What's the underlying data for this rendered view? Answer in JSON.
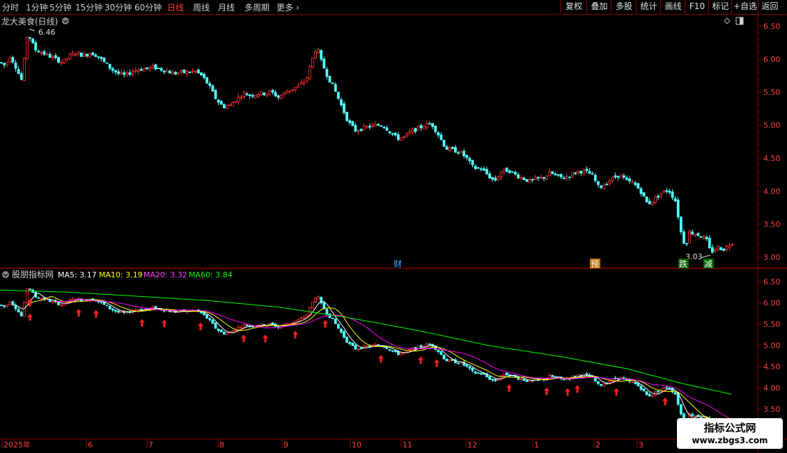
{
  "toolbar": {
    "periods": [
      "分时",
      "1分钟",
      "5分钟",
      "15分钟",
      "30分钟",
      "60分钟",
      "日线",
      "周线",
      "月线",
      "多周期",
      "更多"
    ],
    "active_period": "日线",
    "buttons": [
      "复权",
      "叠加",
      "多股",
      "统计",
      "画线",
      "F10",
      "标记",
      "+自选",
      "返回"
    ]
  },
  "main_chart": {
    "title": "龙大美食(日线)",
    "high_label": "6.46",
    "low_label": "3.03",
    "events": [
      "财",
      "预",
      "跌",
      "减"
    ]
  },
  "indicator": {
    "name": "股朋指标网",
    "ma5": "MA5: 3.17",
    "ma10": "MA10: 3.19",
    "ma20": "MA20: 3.32",
    "ma60": "MA60: 3.84"
  },
  "x_axis": {
    "labels": [
      "2025年",
      "6",
      "7",
      "8",
      "9",
      "10",
      "11",
      "12",
      "1",
      "2",
      "3"
    ]
  },
  "watermark": {
    "title": "指标公式网",
    "url": "www.zbgs3.com"
  },
  "colors": {
    "up": "#ff3232",
    "down": "#54ffff",
    "ma5": "#ffffff",
    "ma10": "#ffff00",
    "ma20": "#ff00ff",
    "ma60": "#00ff00",
    "grid": "#8b0000"
  },
  "chart_data": {
    "type": "candlestick",
    "price_ticks": [
      "6.50",
      "6.00",
      "5.50",
      "5.00",
      "4.50",
      "4.00",
      "3.50",
      "3.00"
    ],
    "sub_price_ticks": [
      "6.50",
      "6.00",
      "5.50",
      "5.00",
      "4.50",
      "4.00",
      "3.50"
    ],
    "ylim": [
      2.95,
      6.55
    ],
    "sub_ylim": [
      3.35,
      6.6
    ],
    "path": [
      [
        0,
        5.95
      ],
      [
        8,
        5.9
      ],
      [
        14,
        6.05
      ],
      [
        20,
        5.95
      ],
      [
        26,
        5.8
      ],
      [
        30,
        5.7
      ],
      [
        33,
        5.65
      ],
      [
        36,
        6.2
      ],
      [
        40,
        6.4
      ],
      [
        44,
        6.3
      ],
      [
        50,
        6.15
      ],
      [
        60,
        6.1
      ],
      [
        70,
        6.05
      ],
      [
        80,
        6.0
      ],
      [
        90,
        5.95
      ],
      [
        100,
        6.05
      ],
      [
        110,
        6.1
      ],
      [
        120,
        6.05
      ],
      [
        130,
        6.1
      ],
      [
        140,
        6.05
      ],
      [
        150,
        5.95
      ],
      [
        160,
        5.85
      ],
      [
        170,
        5.78
      ],
      [
        180,
        5.75
      ],
      [
        190,
        5.82
      ],
      [
        200,
        5.85
      ],
      [
        210,
        5.85
      ],
      [
        220,
        5.88
      ],
      [
        230,
        5.85
      ],
      [
        240,
        5.82
      ],
      [
        250,
        5.78
      ],
      [
        260,
        5.8
      ],
      [
        270,
        5.8
      ],
      [
        280,
        5.82
      ],
      [
        290,
        5.75
      ],
      [
        300,
        5.6
      ],
      [
        310,
        5.4
      ],
      [
        320,
        5.28
      ],
      [
        330,
        5.3
      ],
      [
        340,
        5.4
      ],
      [
        350,
        5.48
      ],
      [
        360,
        5.45
      ],
      [
        370,
        5.48
      ],
      [
        380,
        5.48
      ],
      [
        390,
        5.5
      ],
      [
        400,
        5.42
      ],
      [
        410,
        5.5
      ],
      [
        420,
        5.55
      ],
      [
        430,
        5.6
      ],
      [
        440,
        5.7
      ],
      [
        450,
        6.05
      ],
      [
        455,
        6.2
      ],
      [
        460,
        6.0
      ],
      [
        470,
        5.75
      ],
      [
        480,
        5.55
      ],
      [
        490,
        5.3
      ],
      [
        500,
        5.05
      ],
      [
        510,
        4.92
      ],
      [
        520,
        4.95
      ],
      [
        530,
        4.98
      ],
      [
        540,
        5.0
      ],
      [
        550,
        5.0
      ],
      [
        560,
        4.9
      ],
      [
        570,
        4.8
      ],
      [
        580,
        4.82
      ],
      [
        590,
        4.9
      ],
      [
        600,
        4.95
      ],
      [
        610,
        5.0
      ],
      [
        620,
        5.02
      ],
      [
        630,
        4.85
      ],
      [
        640,
        4.65
      ],
      [
        650,
        4.62
      ],
      [
        660,
        4.6
      ],
      [
        670,
        4.5
      ],
      [
        680,
        4.35
      ],
      [
        690,
        4.35
      ],
      [
        700,
        4.25
      ],
      [
        710,
        4.15
      ],
      [
        720,
        4.3
      ],
      [
        730,
        4.32
      ],
      [
        740,
        4.25
      ],
      [
        750,
        4.2
      ],
      [
        760,
        4.15
      ],
      [
        770,
        4.18
      ],
      [
        780,
        4.2
      ],
      [
        790,
        4.28
      ],
      [
        800,
        4.22
      ],
      [
        810,
        4.2
      ],
      [
        820,
        4.25
      ],
      [
        830,
        4.3
      ],
      [
        840,
        4.3
      ],
      [
        850,
        4.25
      ],
      [
        860,
        4.05
      ],
      [
        870,
        4.12
      ],
      [
        880,
        4.2
      ],
      [
        890,
        4.25
      ],
      [
        900,
        4.15
      ],
      [
        910,
        4.12
      ],
      [
        920,
        4.0
      ],
      [
        930,
        3.8
      ],
      [
        940,
        3.88
      ],
      [
        950,
        3.98
      ],
      [
        960,
        4.02
      ],
      [
        970,
        3.85
      ],
      [
        975,
        3.55
      ],
      [
        980,
        3.25
      ],
      [
        985,
        3.2
      ],
      [
        990,
        3.38
      ],
      [
        1000,
        3.35
      ],
      [
        1010,
        3.3
      ],
      [
        1015,
        3.25
      ],
      [
        1020,
        3.08
      ],
      [
        1025,
        3.1
      ],
      [
        1030,
        3.15
      ],
      [
        1040,
        3.12
      ],
      [
        1050,
        3.22
      ]
    ],
    "ma60_points": [
      [
        0,
        6.3
      ],
      [
        100,
        6.25
      ],
      [
        200,
        6.15
      ],
      [
        300,
        6.05
      ],
      [
        400,
        5.9
      ],
      [
        500,
        5.65
      ],
      [
        600,
        5.35
      ],
      [
        700,
        5.0
      ],
      [
        800,
        4.75
      ],
      [
        900,
        4.45
      ],
      [
        980,
        4.1
      ],
      [
        1050,
        3.85
      ]
    ],
    "arrows_x": [
      43,
      113,
      138,
      204,
      236,
      288,
      350,
      381,
      424,
      467,
      547,
      604,
      627,
      731,
      785,
      815,
      829,
      885,
      955
    ]
  }
}
